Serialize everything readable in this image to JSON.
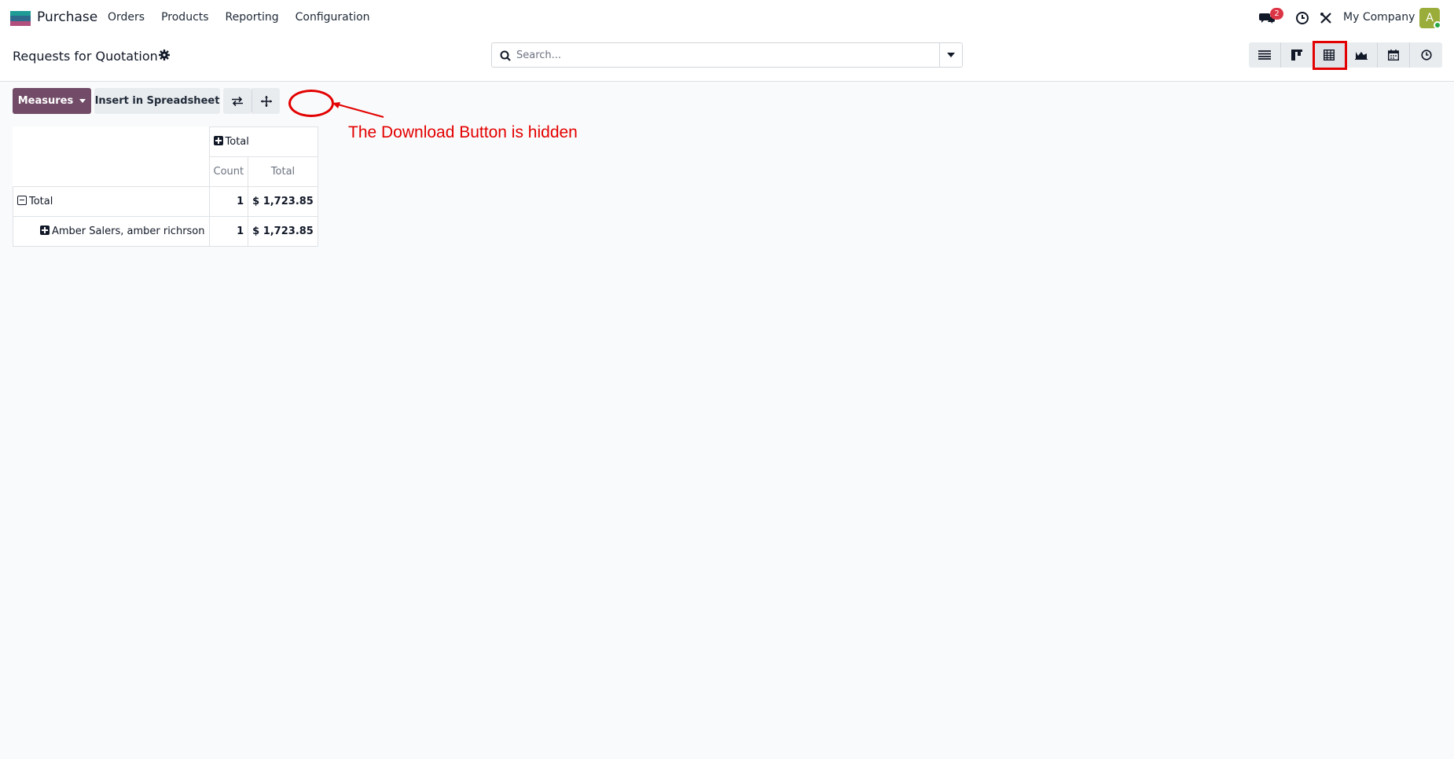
{
  "navbar": {
    "app_name": "Purchase",
    "menu": [
      "Orders",
      "Products",
      "Reporting",
      "Configuration"
    ],
    "chat_badge": "2",
    "company": "My Company",
    "avatar_letter": "A"
  },
  "control_panel": {
    "title": "Requests for Quotation",
    "search_placeholder": "Search...",
    "views": [
      "list-view",
      "kanban-view",
      "pivot-view",
      "graph-view",
      "calendar-view",
      "activity-view"
    ],
    "active_view": "pivot-view"
  },
  "toolbar": {
    "measures_label": "Measures",
    "spreadsheet_label": "Insert in Spreadsheet"
  },
  "annotation": {
    "text": "The Download Button is hidden",
    "color": "#e30000"
  },
  "pivot": {
    "col_header": "Total",
    "measures": [
      "Count",
      "Total"
    ],
    "rows": [
      {
        "label": "Total",
        "count": "1",
        "total": "$ 1,723.85"
      },
      {
        "label": "Amber Salers, amber richrson",
        "count": "1",
        "total": "$ 1,723.85"
      }
    ]
  },
  "colors": {
    "brand": "#714b67",
    "badge": "#dc3545"
  }
}
